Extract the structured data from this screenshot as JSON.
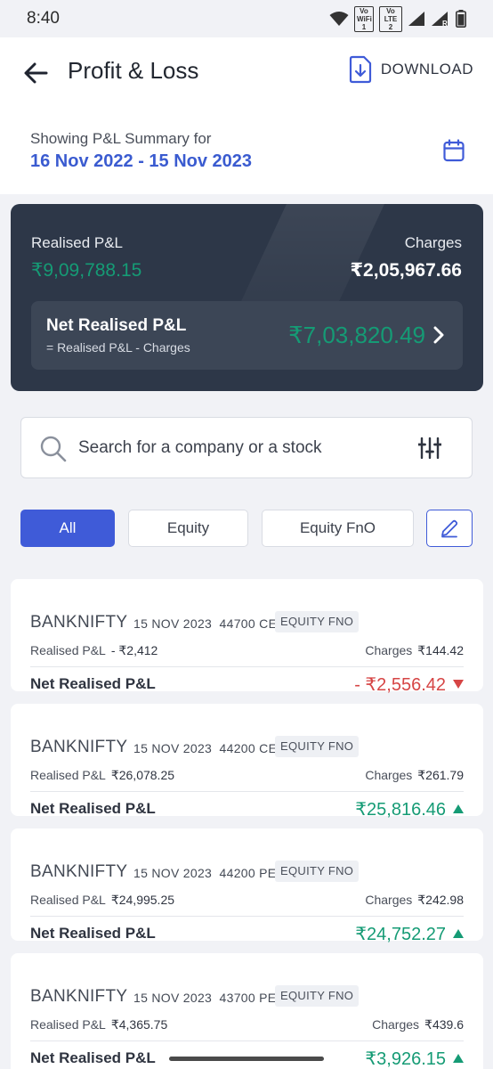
{
  "status_bar": {
    "time": "8:40",
    "vowifi_label": "Vo WiFi 1",
    "volte_label": "Vo LTE 2",
    "roaming_label": "R",
    "icons": [
      "wifi-icon",
      "signal-icon",
      "signal-roaming-icon",
      "battery-icon"
    ]
  },
  "header": {
    "title": "Profit & Loss",
    "download_label": "DOWNLOAD",
    "summary_label": "Showing P&L Summary for",
    "date_range": "16 Nov 2022 - 15 Nov 2023"
  },
  "summary_card": {
    "realised_label": "Realised P&L",
    "realised_value": "₹9,09,788.15",
    "charges_label": "Charges",
    "charges_value": "₹2,05,967.66",
    "net_label": "Net Realised P&L",
    "net_formula": "= Realised P&L - Charges",
    "net_value": "₹7,03,820.49"
  },
  "search": {
    "placeholder": "Search for a company or a stock"
  },
  "filters": {
    "tabs": [
      {
        "label": "All",
        "active": true
      },
      {
        "label": "Equity",
        "active": false
      },
      {
        "label": "Equity FnO",
        "active": false
      }
    ]
  },
  "trades": [
    {
      "symbol": "BANKNIFTY",
      "expiry": "15 NOV 2023",
      "strike": "44700",
      "option_type": "CE",
      "segment": "EQUITY FNO",
      "realised_label": "Realised P&L",
      "realised_value": "- ₹2,412",
      "charges_label": "Charges",
      "charges_value": "₹144.42",
      "net_label": "Net Realised P&L",
      "net_value": "- ₹2,556.42",
      "direction": "down"
    },
    {
      "symbol": "BANKNIFTY",
      "expiry": "15 NOV 2023",
      "strike": "44200",
      "option_type": "CE",
      "segment": "EQUITY FNO",
      "realised_label": "Realised P&L",
      "realised_value": "₹26,078.25",
      "charges_label": "Charges",
      "charges_value": "₹261.79",
      "net_label": "Net Realised P&L",
      "net_value": "₹25,816.46",
      "direction": "up"
    },
    {
      "symbol": "BANKNIFTY",
      "expiry": "15 NOV 2023",
      "strike": "44200",
      "option_type": "PE",
      "segment": "EQUITY FNO",
      "realised_label": "Realised P&L",
      "realised_value": "₹24,995.25",
      "charges_label": "Charges",
      "charges_value": "₹242.98",
      "net_label": "Net Realised P&L",
      "net_value": "₹24,752.27",
      "direction": "up"
    },
    {
      "symbol": "BANKNIFTY",
      "expiry": "15 NOV 2023",
      "strike": "43700",
      "option_type": "PE",
      "segment": "EQUITY FNO",
      "realised_label": "Realised P&L",
      "realised_value": "₹4,365.75",
      "charges_label": "Charges",
      "charges_value": "₹439.6",
      "net_label": "Net Realised P&L",
      "net_value": "₹3,926.15",
      "direction": "up"
    }
  ],
  "colors": {
    "accent": "#3f5bd8",
    "date_range": "#3a5bd0",
    "positive": "#159b75",
    "negative": "#d64545",
    "card_dark": "#2d3748"
  }
}
